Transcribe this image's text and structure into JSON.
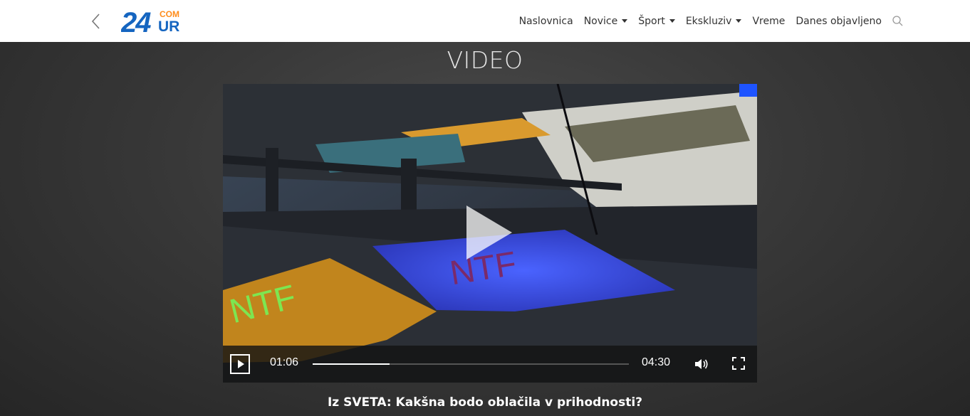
{
  "header": {
    "logo": {
      "number": "24",
      "suffix_top": "COM",
      "suffix_bottom": "UR"
    },
    "nav": [
      {
        "label": "Naslovnica",
        "dropdown": false
      },
      {
        "label": "Novice",
        "dropdown": true
      },
      {
        "label": "Šport",
        "dropdown": true
      },
      {
        "label": "Ekskluziv",
        "dropdown": true
      },
      {
        "label": "Vreme",
        "dropdown": false
      },
      {
        "label": "Danes objavljeno",
        "dropdown": false
      }
    ],
    "icons": {
      "back": "chevron-left-icon",
      "search": "search-icon"
    }
  },
  "section": {
    "title": "VIDEO"
  },
  "player": {
    "current_time": "01:06",
    "duration": "04:30",
    "progress_fraction": 0.244,
    "state": "paused",
    "icons": {
      "big_play": "play-icon",
      "play": "play-icon",
      "volume": "volume-icon",
      "fullscreen": "fullscreen-icon"
    },
    "scene_text": {
      "blue_cloth": "NTF",
      "orange_cloth": "NTF"
    }
  },
  "caption": "Iz SVETA: Kakšna bodo oblačila v prihodnosti?",
  "colors": {
    "logo_blue": "#1565c0",
    "logo_orange": "#ff8c1a",
    "stage_bg": "#383838",
    "cloth_blue": "#3b4fd6",
    "cloth_orange": "#c98a1c"
  }
}
